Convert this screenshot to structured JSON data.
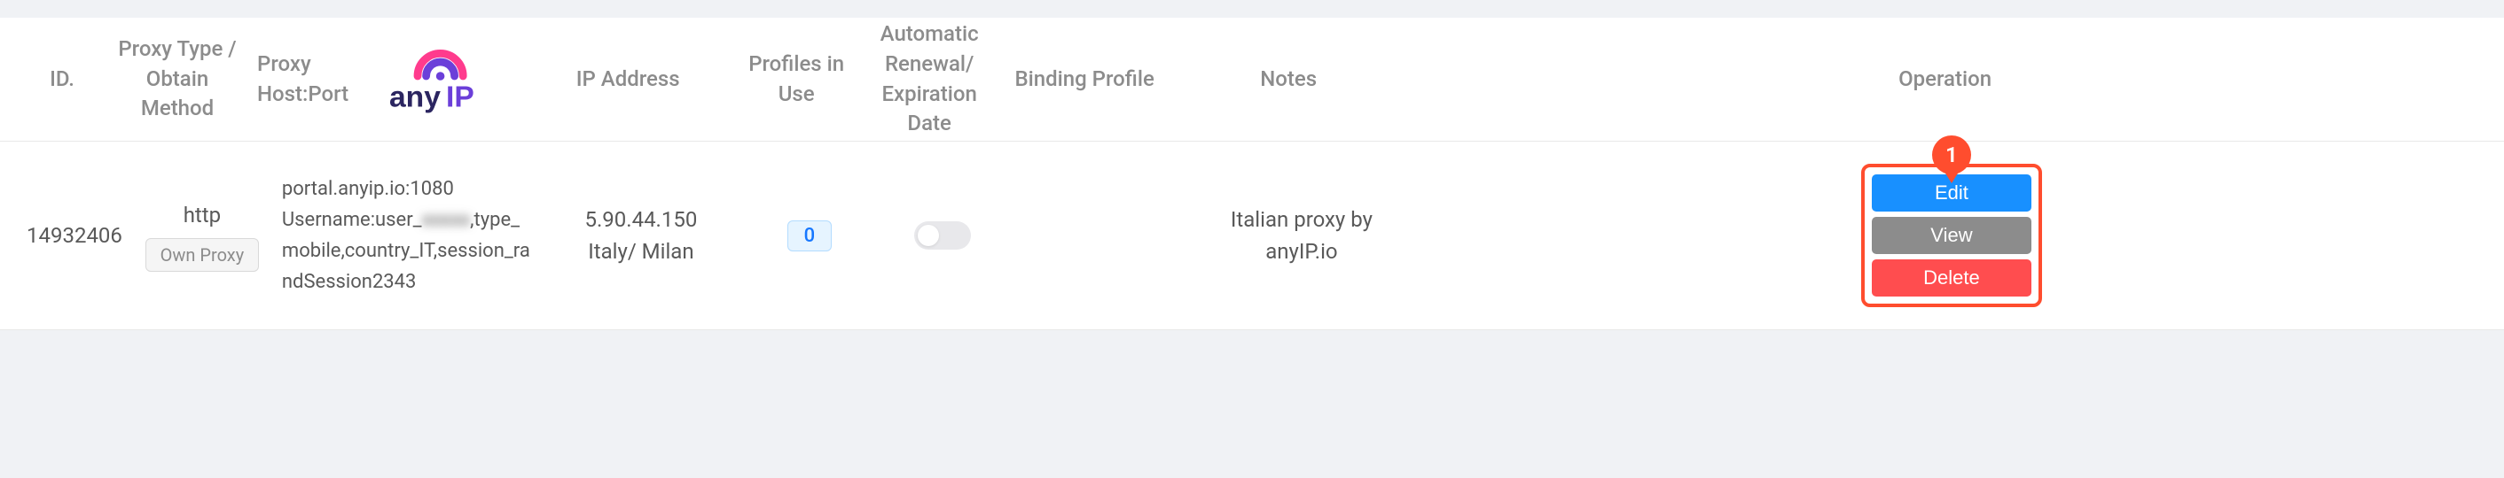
{
  "headers": {
    "id": "ID.",
    "proxy_type": "Proxy Type / Obtain Method",
    "host_port": "Proxy Host:Port",
    "ip_address": "IP Address",
    "profiles": "Profiles in Use",
    "renewal": "Automatic Renewal/ Expiration Date",
    "binding": "Binding Profile",
    "notes": "Notes",
    "operation": "Operation"
  },
  "row": {
    "id": "14932406",
    "proxy_type": "http",
    "own_proxy_label": "Own Proxy",
    "host_port_line1": "portal.anyip.io:1080",
    "host_port_line2_prefix": "Username:user_",
    "host_port_line2_blur": "xxxxx",
    "host_port_line2_suffix": ",type_mobile,country_IT,session_randSession2343",
    "ip_line1": "5.90.44.150",
    "ip_line2": "Italy/ Milan",
    "profiles_count": "0",
    "renewal_toggle": false,
    "binding": "",
    "notes": "Italian proxy by anyIP.io"
  },
  "operations": {
    "edit": "Edit",
    "view": "View",
    "delete": "Delete"
  },
  "annotation": {
    "marker_number": "1"
  },
  "logo": {
    "brand_text": "anyIP"
  }
}
